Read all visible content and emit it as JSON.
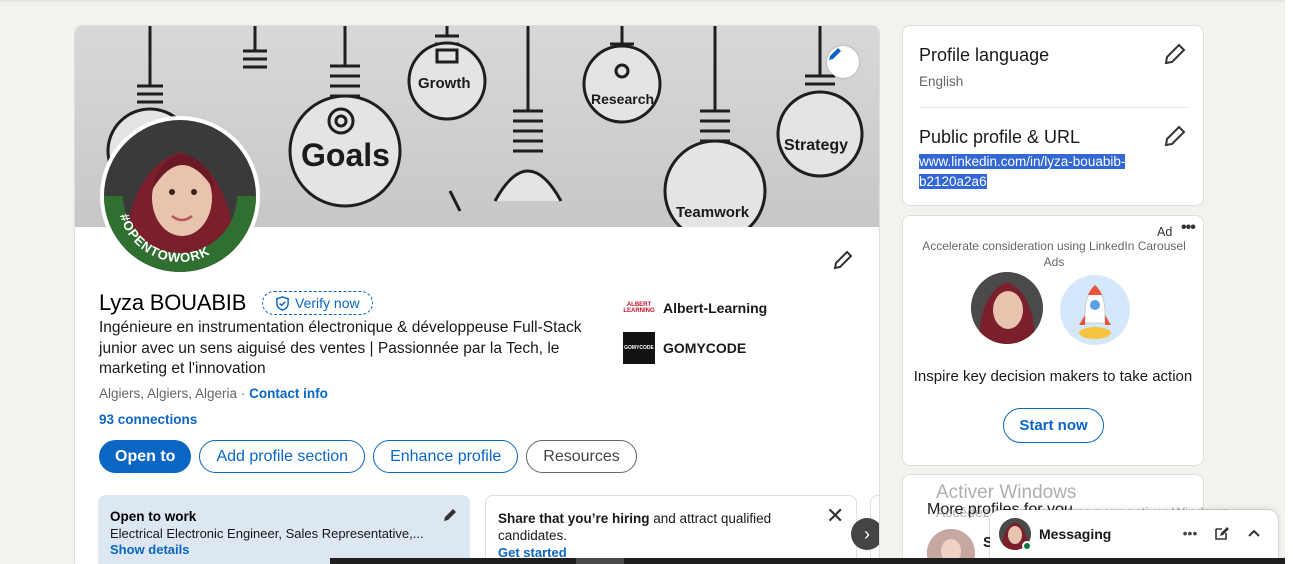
{
  "profile": {
    "name": "Lyza BOUABIB",
    "verify_label": "Verify now",
    "headline": "Ingénieure en instrumentation électronique & développeuse Full-Stack junior avec un sens aiguisé des ventes | Passionnée par la Tech, le marketing et l'innovation",
    "location": "Algiers, Algiers, Algeria",
    "separator": "·",
    "contact_info": "Contact info",
    "connections": "93 connections",
    "avatar_badge": "#OPENTOWORK",
    "companies": [
      {
        "name": "Albert-Learning",
        "logo_text": "ALBERT LEARNING"
      },
      {
        "name": "GOMYCODE",
        "logo_text": "GOMYCODE"
      }
    ],
    "actions": {
      "open_to": "Open to",
      "add_section": "Add profile section",
      "enhance": "Enhance profile",
      "resources": "Resources"
    },
    "banner_words": [
      "Growth",
      "Research",
      "Goals",
      "Strategy",
      "Teamwork"
    ]
  },
  "open_to_work": {
    "title": "Open to work",
    "roles": "Electrical Electronic Engineer, Sales Representative,...",
    "link": "Show details"
  },
  "hiring": {
    "bold": "Share that you’re hiring",
    "rest": " and attract qualified candidates.",
    "link": "Get started",
    "close": "✕"
  },
  "carousel_next": "›",
  "sidebar": {
    "language_title": "Profile language",
    "language_value": "English",
    "url_title": "Public profile & URL",
    "url_line1": "www.linkedin.com/in/lyza-bouabib-",
    "url_line2": "b2120a2a6"
  },
  "ad": {
    "label": "Ad",
    "more": "•••",
    "text": "Accelerate consideration using LinkedIn Carousel Ads",
    "tagline": "Inspire key decision makers to take action",
    "cta": "Start now"
  },
  "more_profiles": {
    "title": "More profiles for you",
    "first_initial": "S"
  },
  "watermark": {
    "line1": "Activer Windows",
    "line2": "Accédez aux paramètres pour activer Windows."
  },
  "messaging": {
    "label": "Messaging",
    "more": "•••"
  },
  "colors": {
    "accent": "#0a66c2",
    "open_to_work_green": "#2f6f2f",
    "page_bg": "#f4f2ee"
  },
  "icons": [
    "pencil-icon",
    "shield-check-icon",
    "close-icon",
    "chevron-right-icon",
    "compose-icon",
    "chevron-up-icon",
    "more-icon",
    "rocket-icon"
  ]
}
